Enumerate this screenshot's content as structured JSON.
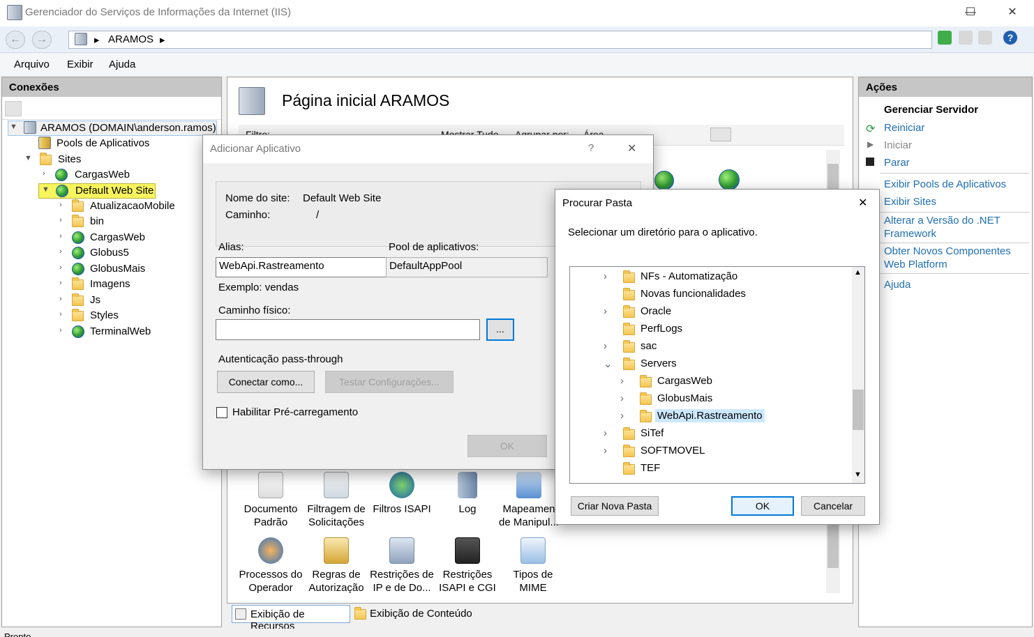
{
  "window": {
    "title": "Gerenciador do Serviços de Informações da Internet (IIS)",
    "minimize": "—",
    "maximize": "☐",
    "close": "✕"
  },
  "address": {
    "back": "←",
    "forward": "→",
    "sep1": "▸",
    "server": "ARAMOS",
    "sep2": "▸"
  },
  "menu": [
    "Arquivo",
    "Exibir",
    "Ajuda"
  ],
  "connections": {
    "header": "Conexões",
    "tree": {
      "root": "ARAMOS (DOMAIN\\anderson.ramos)",
      "pools": "Pools de Aplicativos",
      "sites": "Sites",
      "site1": "CargasWeb",
      "site2": "Default Web Site",
      "children": [
        "AtualizacaoMobile",
        "bin",
        "CargasWeb",
        "Globus5",
        "GlobusMais",
        "Imagens",
        "Js",
        "Styles",
        "TerminalWeb"
      ]
    }
  },
  "main": {
    "title": "Página inicial ARAMOS",
    "filter_label": "Filtro:",
    "show_all": "Mostrar Tudo",
    "group_by": "Agrupar por:",
    "group_value": "Área",
    "features_row1": [
      {
        "line1": "Documento",
        "line2": "Padrão"
      },
      {
        "line1": "Filtragem de",
        "line2": "Solicitações"
      },
      {
        "line1": "Filtros ISAPI",
        "line2": ""
      },
      {
        "line1": "Log",
        "line2": ""
      },
      {
        "line1": "Mapeamen",
        "line2": "de Manipul..."
      }
    ],
    "features_row2": [
      {
        "line1": "Processos do",
        "line2": "Operador"
      },
      {
        "line1": "Regras de",
        "line2": "Autorização"
      },
      {
        "line1": "Restrições de",
        "line2": "IP e de Do..."
      },
      {
        "line1": "Restrições",
        "line2": "ISAPI e CGI"
      },
      {
        "line1": "Tipos de",
        "line2": "MIME"
      }
    ],
    "tab_features": "Exibição de Recursos",
    "tab_content": "Exibição de Conteúdo"
  },
  "actions": {
    "header": "Ações",
    "manage_server": "Gerenciar Servidor",
    "restart": "Reiniciar",
    "start": "Iniciar",
    "stop": "Parar",
    "view_pools": "Exibir Pools de Aplicativos",
    "view_sites": "Exibir Sites",
    "change_net_1": "Alterar a Versão do .NET",
    "change_net_2": "Framework",
    "get_components_1": "Obter Novos Componentes",
    "get_components_2": "Web Platform",
    "help": "Ajuda"
  },
  "add_app_dialog": {
    "title": "Adicionar Aplicativo",
    "help": "?",
    "close": "✕",
    "site_name_label": "Nome do site:",
    "site_name_value": "Default Web Site",
    "path_label": "Caminho:",
    "path_value": "/",
    "alias_label": "Alias:",
    "alias_value": "WebApi.Rastreamento",
    "pool_label": "Pool de aplicativos:",
    "pool_value": "DefaultAppPool",
    "example": "Exemplo: vendas",
    "physical_path_label": "Caminho físico:",
    "physical_path_value": "",
    "browse": "...",
    "passthrough_label": "Autenticação pass-through",
    "connect_as": "Conectar como...",
    "test_settings": "Testar Configurações...",
    "preload_label": "Habilitar Pré-carregamento",
    "ok": "OK"
  },
  "browse_dialog": {
    "title": "Procurar Pasta",
    "close": "✕",
    "instruction": "Selecionar um diretório para o aplicativo.",
    "items": [
      {
        "name": "NFs - Automatização",
        "caret": "›",
        "level": 0
      },
      {
        "name": "Novas funcionalidades",
        "caret": "",
        "level": 0
      },
      {
        "name": "Oracle",
        "caret": "›",
        "level": 0
      },
      {
        "name": "PerfLogs",
        "caret": "",
        "level": 0
      },
      {
        "name": "sac",
        "caret": "›",
        "level": 0
      },
      {
        "name": "Servers",
        "caret": "⌄",
        "level": 0
      },
      {
        "name": "CargasWeb",
        "caret": "›",
        "level": 1
      },
      {
        "name": "GlobusMais",
        "caret": "›",
        "level": 1
      },
      {
        "name": "WebApi.Rastreamento",
        "caret": "›",
        "level": 1,
        "selected": true
      },
      {
        "name": "SiTef",
        "caret": "›",
        "level": 0
      },
      {
        "name": "SOFTMOVEL",
        "caret": "›",
        "level": 0
      },
      {
        "name": "TEF",
        "caret": "",
        "level": 0
      }
    ],
    "new_folder": "Criar Nova Pasta",
    "ok": "OK",
    "cancel": "Cancelar"
  },
  "status": {
    "text": "Pronto"
  },
  "colors": {
    "selection_yellow": "#f7f45e",
    "link_blue": "#1f6fb2",
    "tree_selection": "#cce8ff",
    "accent": "#0078d7"
  }
}
